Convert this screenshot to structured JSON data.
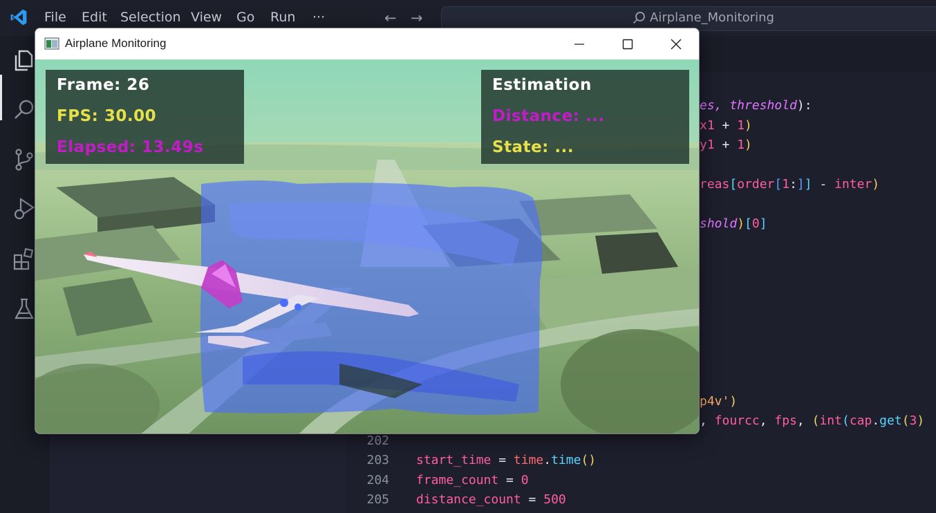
{
  "vscode": {
    "menu": [
      "File",
      "Edit",
      "Selection",
      "View",
      "Go",
      "Run",
      "···"
    ],
    "search_text": "Airplane_Monitoring",
    "activity_icons": [
      "explorer-icon",
      "search-icon",
      "source-control-icon",
      "run-debug-icon",
      "extensions-icon",
      "testing-icon"
    ]
  },
  "editor": {
    "visible_code_right": [
      {
        "text": "es, threshold):"
      },
      {
        "text": "x1 + 1)"
      },
      {
        "text": "y1 + 1)"
      },
      {
        "text": "reas[order[1:]] - inter)"
      },
      {
        "text": "shold)[0]"
      },
      {
        "text": "p4v')"
      },
      {
        "text": ", fourcc, fps, (int(cap.get(3)"
      }
    ],
    "lines": [
      {
        "num": "202",
        "code": ""
      },
      {
        "num": "203",
        "code_parts": [
          "start_time",
          " = ",
          "time",
          ".",
          "time",
          "()"
        ]
      },
      {
        "num": "204",
        "code_parts": [
          "frame_count",
          " = ",
          "0"
        ]
      },
      {
        "num": "205",
        "code_parts": [
          "distance_count",
          " = ",
          "500"
        ]
      }
    ]
  },
  "cv_window": {
    "title": "Airplane Monitoring",
    "controls": [
      "minimize-icon",
      "maximize-icon",
      "close-icon"
    ]
  },
  "overlay": {
    "left": {
      "frame": "Frame: 26",
      "fps": "FPS: 30.00",
      "elapsed": "Elapsed: 13.49s"
    },
    "right": {
      "title": "Estimation",
      "distance": "Distance: ...",
      "state": "State: ..."
    }
  },
  "colors": {
    "overlay_white": "#ffffff",
    "overlay_yellow": "#e6e04a",
    "overlay_magenta": "#c21cc8",
    "mask_blue": "#4a6cff"
  }
}
